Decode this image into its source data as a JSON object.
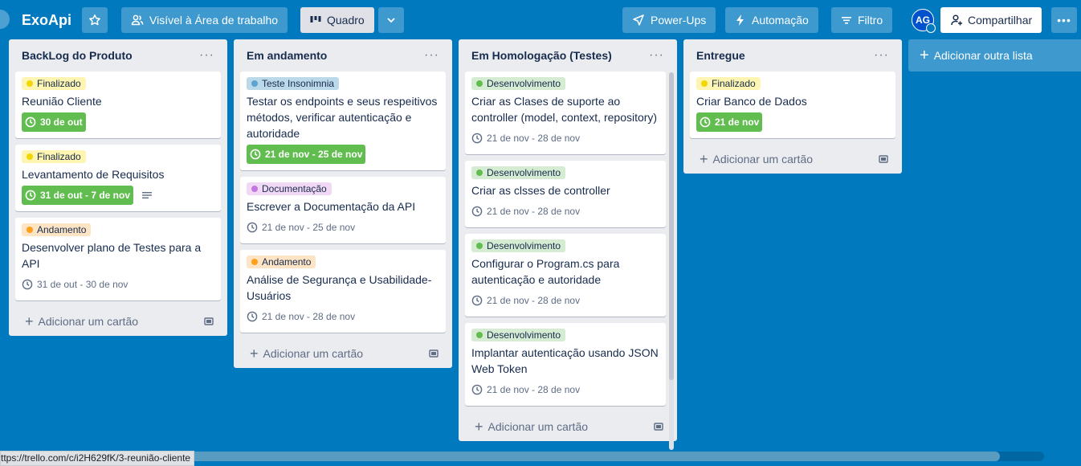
{
  "header": {
    "board_name": "ExoApi",
    "visibility": "Visível à Área de trabalho",
    "view": "Quadro",
    "power_ups": "Power-Ups",
    "automation": "Automação",
    "filter": "Filtro",
    "avatar_initials": "AG",
    "share": "Compartilhar"
  },
  "lists": [
    {
      "title": "BackLog do Produto",
      "add_card": "Adicionar um cartão",
      "cards": [
        {
          "label": "Finalizado",
          "label_color": "#fdf5b1",
          "dot_color": "#f2d600",
          "title": "Reunião Cliente",
          "date": "30 de out",
          "date_done": true
        },
        {
          "label": "Finalizado",
          "label_color": "#fdf5b1",
          "dot_color": "#f2d600",
          "title": "Levantamento de Requisitos",
          "date": "31 de out - 7 de nov",
          "date_done": true
        },
        {
          "label": "Andamento",
          "label_color": "#fde4c5",
          "dot_color": "#ff9f1a",
          "title": "Desenvolver plano de Testes para a API",
          "date": "31 de out - 30 de nov",
          "date_done": false
        }
      ]
    },
    {
      "title": "Em andamento",
      "add_card": "Adicionar um cartão",
      "cards": [
        {
          "label": "Teste Insonimnia",
          "label_color": "#bcd9ea",
          "dot_color": "#5ba4cf",
          "title": "Testar os endpoints e seus respeitivos métodos, verificar autenticação e autoridade",
          "date": "21 de nov - 25 de nov",
          "date_done": true
        },
        {
          "label": "Documentação",
          "label_color": "#f1d9f5",
          "dot_color": "#c377e0",
          "title": "Escrever a Documentação da API",
          "date": "21 de nov - 25 de nov",
          "date_done": false
        },
        {
          "label": "Andamento",
          "label_color": "#fde4c5",
          "dot_color": "#ff9f1a",
          "title": "Análise de Segurança e Usabilidade-Usuários",
          "date": "21 de nov - 28 de nov",
          "date_done": false
        }
      ]
    },
    {
      "title": "Em Homologação (Testes)",
      "add_card": "Adicionar um cartão",
      "cards": [
        {
          "label": "Desenvolvimento",
          "label_color": "#d6ecd2",
          "dot_color": "#61bd4f",
          "title": "Criar as Clases de suporte ao controller (model, context, repository)",
          "date": "21 de nov - 28 de nov",
          "date_done": false
        },
        {
          "label": "Desenvolvimento",
          "label_color": "#d6ecd2",
          "dot_color": "#61bd4f",
          "title": "Criar as clsses de controller",
          "date": "21 de nov - 28 de nov",
          "date_done": false
        },
        {
          "label": "Desenvolvimento",
          "label_color": "#d6ecd2",
          "dot_color": "#61bd4f",
          "title": "Configurar o Program.cs para autenticação e autoridade",
          "date": "21 de nov - 28 de nov",
          "date_done": false
        },
        {
          "label": "Desenvolvimento",
          "label_color": "#d6ecd2",
          "dot_color": "#61bd4f",
          "title": "Implantar autenticação usando JSON Web Token",
          "date": "21 de nov - 28 de nov",
          "date_done": false
        }
      ]
    },
    {
      "title": "Entregue",
      "add_card": "Adicionar um cartão",
      "cards": [
        {
          "label": "Finalizado",
          "label_color": "#fdf5b1",
          "dot_color": "#f2d600",
          "title": "Criar Banco de Dados",
          "date": "21 de nov",
          "date_done": true
        }
      ]
    }
  ],
  "add_list": "Adicionar outra lista",
  "status_url": "ttps://trello.com/c/i2H629fK/3-reunião-cliente",
  "colors": {
    "board_bg": "#0079bf",
    "done_green": "#61bd4f"
  }
}
